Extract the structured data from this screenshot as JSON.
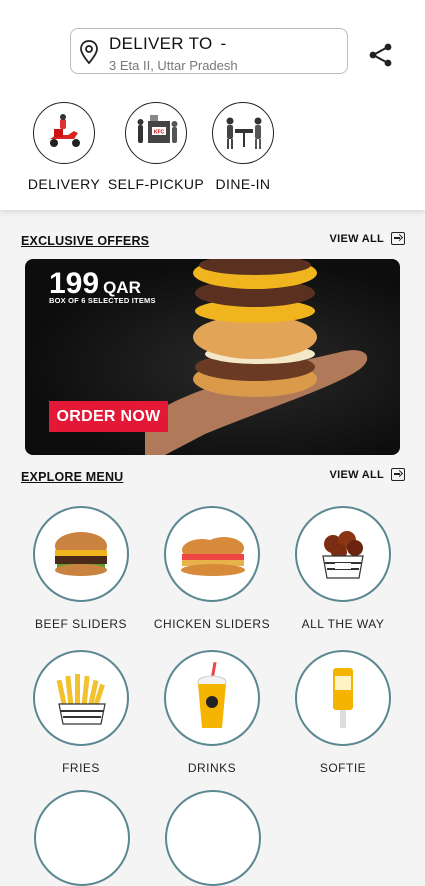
{
  "header": {
    "deliver_title": "DELIVER TO",
    "deliver_dash": "-",
    "address": "3 Eta II, Uttar Pradesh"
  },
  "modes": [
    {
      "label": "DELIVERY"
    },
    {
      "label": "SELF-PICKUP"
    },
    {
      "label": "DINE-IN"
    }
  ],
  "offers": {
    "title": "EXCLUSIVE OFFERS",
    "view_all": "VIEW ALL",
    "banner": {
      "price": "199",
      "currency": "QAR",
      "subtitle": "BOX OF 6 SELECTED ITEMS",
      "cta": "ORDER NOW"
    }
  },
  "menu": {
    "title": "EXPLORE MENU",
    "view_all": "VIEW ALL",
    "items": [
      {
        "label": "BEEF SLIDERS"
      },
      {
        "label": "CHICKEN SLIDERS"
      },
      {
        "label": "ALL THE WAY"
      },
      {
        "label": "FRIES"
      },
      {
        "label": "DRINKS"
      },
      {
        "label": "SOFTIE"
      }
    ]
  },
  "colors": {
    "accent_red": "#e31837",
    "menu_circle_border": "#5b8791"
  }
}
